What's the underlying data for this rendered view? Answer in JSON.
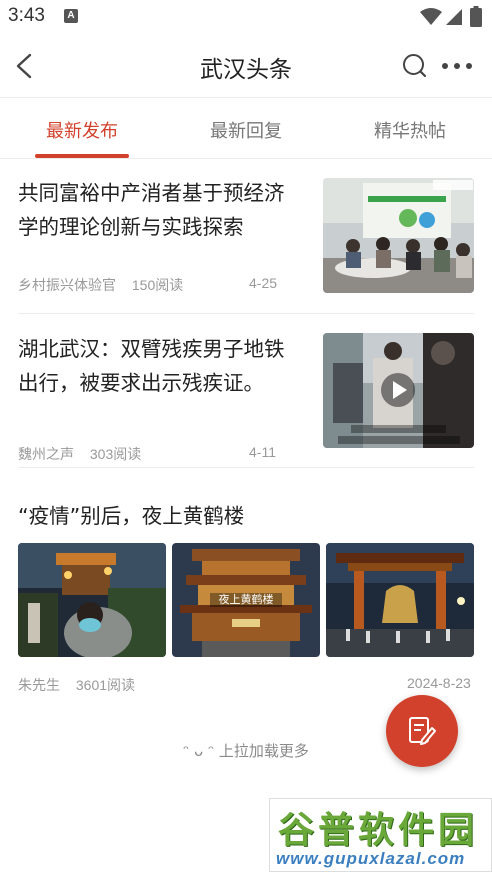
{
  "status_bar": {
    "time": "3:43",
    "notification_icon": "A",
    "icons": [
      "wifi-icon",
      "signal-icon",
      "battery-icon"
    ]
  },
  "nav": {
    "title": "武汉头条",
    "icons": [
      "back-icon",
      "search-icon",
      "more-icon"
    ]
  },
  "tabs": [
    {
      "label": "最新发布",
      "active": true
    },
    {
      "label": "最新回复",
      "active": false
    },
    {
      "label": "精华热帖",
      "active": false
    }
  ],
  "articles": [
    {
      "title": "共同富裕中产消者基于预经济学的理论创新与实践探索",
      "author": "乡村振兴体验官",
      "reads": "150阅读",
      "date": "4-25",
      "thumbnail": "meeting-photo"
    },
    {
      "title": "湖北武汉：双臂残疾男子地铁出行，被要求出示残疾证。",
      "author": "魏州之声",
      "reads": "303阅读",
      "date": "4-11",
      "thumbnail": "video-thumbnail"
    }
  ],
  "gallery_post": {
    "title": "“疫情”别后，夜上黄鹤楼",
    "author": "朱先生",
    "reads": "3601阅读",
    "date": "2024-8-23",
    "images": [
      "night-street-photo",
      "yellow-crane-tower-photo",
      "bell-gate-photo"
    ],
    "image_caption": "夜上黄鹤楼"
  },
  "load_more": "ᵔ ᴗ ᵔ 上拉加载更多",
  "fab_icon": "edit-icon",
  "watermark": {
    "top": "谷普软件园",
    "bottom": "www.gupuxlazal.com"
  },
  "colors": {
    "accent": "#d2412b",
    "text_primary": "#222222",
    "text_secondary": "#999999"
  }
}
